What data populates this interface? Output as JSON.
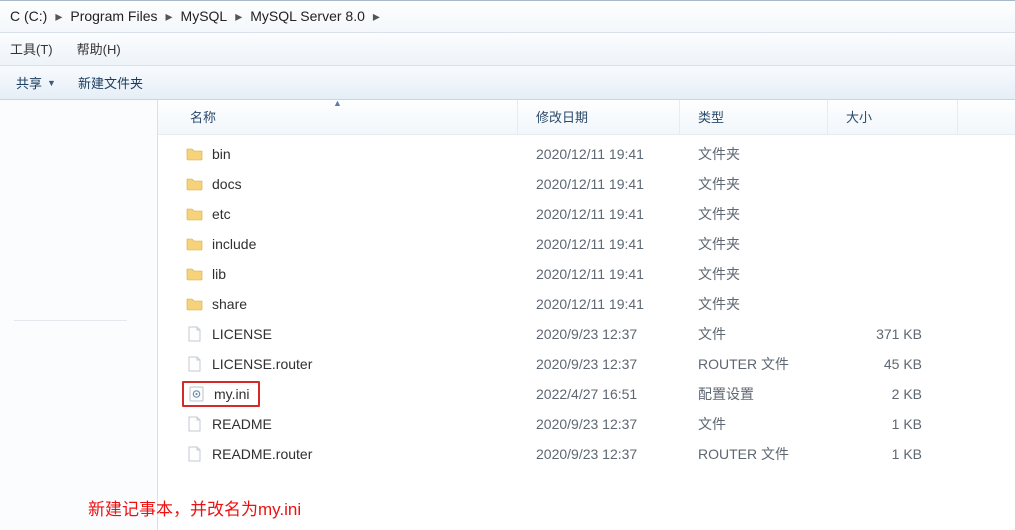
{
  "breadcrumb": {
    "drive": "C (C:)",
    "a": "Program Files",
    "b": "MySQL",
    "c": "MySQL Server 8.0"
  },
  "menubar": {
    "tools": "工具(T)",
    "help": "帮助(H)"
  },
  "toolbar": {
    "share": "共享",
    "new_folder": "新建文件夹"
  },
  "columns": {
    "name": "名称",
    "date": "修改日期",
    "type": "类型",
    "size": "大小"
  },
  "files": [
    {
      "name": "bin",
      "date": "2020/12/11 19:41",
      "type": "文件夹",
      "size": "",
      "icon": "folder"
    },
    {
      "name": "docs",
      "date": "2020/12/11 19:41",
      "type": "文件夹",
      "size": "",
      "icon": "folder"
    },
    {
      "name": "etc",
      "date": "2020/12/11 19:41",
      "type": "文件夹",
      "size": "",
      "icon": "folder"
    },
    {
      "name": "include",
      "date": "2020/12/11 19:41",
      "type": "文件夹",
      "size": "",
      "icon": "folder"
    },
    {
      "name": "lib",
      "date": "2020/12/11 19:41",
      "type": "文件夹",
      "size": "",
      "icon": "folder"
    },
    {
      "name": "share",
      "date": "2020/12/11 19:41",
      "type": "文件夹",
      "size": "",
      "icon": "folder"
    },
    {
      "name": "LICENSE",
      "date": "2020/9/23 12:37",
      "type": "文件",
      "size": "371 KB",
      "icon": "file"
    },
    {
      "name": "LICENSE.router",
      "date": "2020/9/23 12:37",
      "type": "ROUTER 文件",
      "size": "45 KB",
      "icon": "file"
    },
    {
      "name": "my.ini",
      "date": "2022/4/27 16:51",
      "type": "配置设置",
      "size": "2 KB",
      "icon": "ini",
      "highlight": true
    },
    {
      "name": "README",
      "date": "2020/9/23 12:37",
      "type": "文件",
      "size": "1 KB",
      "icon": "file"
    },
    {
      "name": "README.router",
      "date": "2020/9/23 12:37",
      "type": "ROUTER 文件",
      "size": "1 KB",
      "icon": "file"
    }
  ],
  "annotation": "新建记事本，并改名为my.ini"
}
